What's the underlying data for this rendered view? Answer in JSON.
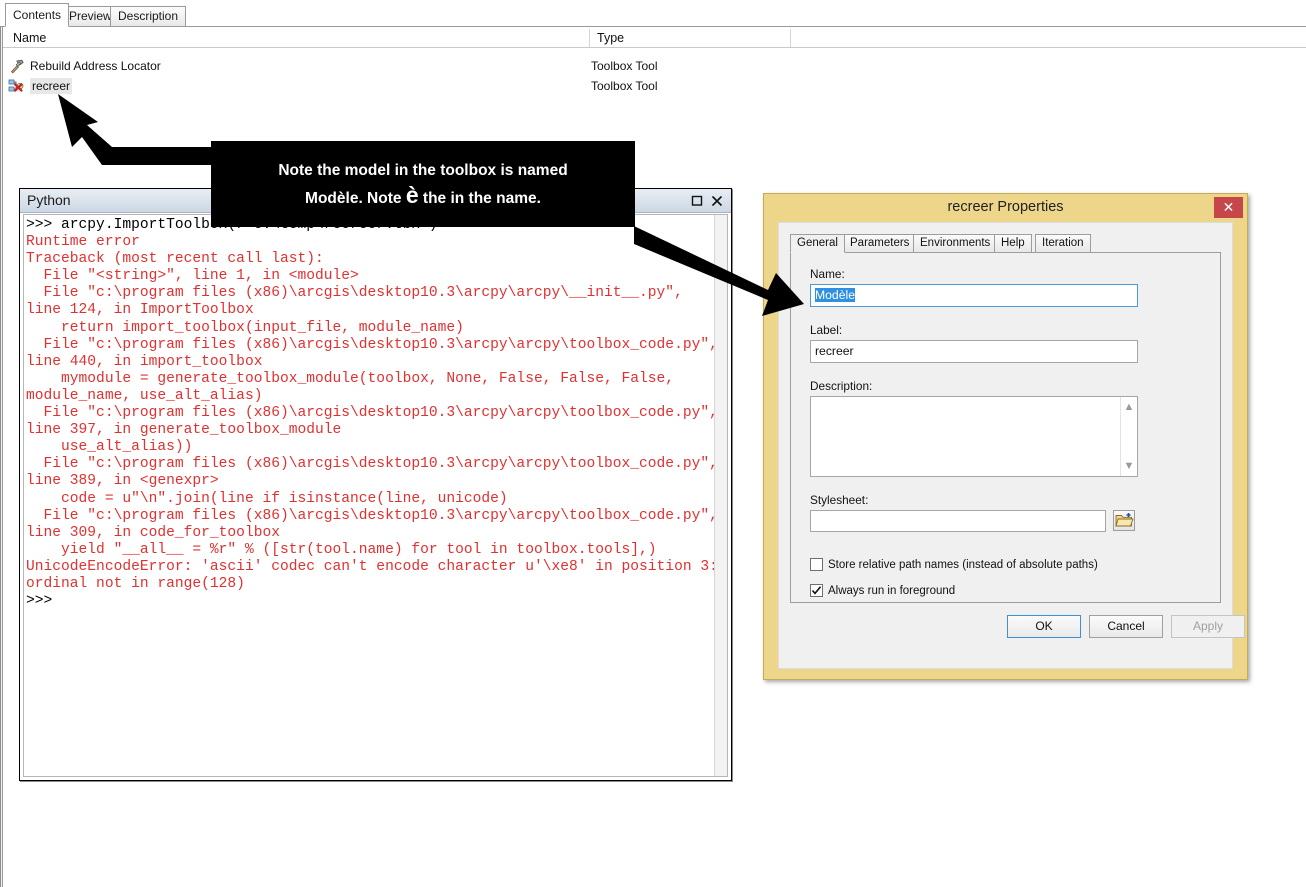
{
  "catalog": {
    "tabs": [
      {
        "label": "Contents",
        "active": true
      },
      {
        "label": "Preview",
        "active": false
      },
      {
        "label": "Description",
        "active": false
      }
    ],
    "columns": [
      "Name",
      "Type"
    ],
    "rows": [
      {
        "name": "Rebuild Address Locator",
        "type": "Toolbox Tool",
        "icon": "hammer-icon",
        "selected": false
      },
      {
        "name": "recreer",
        "type": "Toolbox Tool",
        "icon": "model-broken-icon",
        "selected": true
      }
    ]
  },
  "python_window": {
    "title": "Python",
    "buttons": {
      "maximize": "☐",
      "close": "✕"
    },
    "console_lines": [
      {
        "text": ">>> arcpy.ImportToolbox(r'c:\\temp\\recreer.tbx')",
        "style": "in"
      },
      {
        "text": "Runtime error",
        "style": "err"
      },
      {
        "text": "Traceback (most recent call last):",
        "style": "err"
      },
      {
        "text": "  File \"<string>\", line 1, in <module>",
        "style": "err"
      },
      {
        "text": "  File \"c:\\program files (x86)\\arcgis\\desktop10.3\\arcpy\\arcpy\\__init__.py\", line 124, in ImportToolbox",
        "style": "err"
      },
      {
        "text": "    return import_toolbox(input_file, module_name)",
        "style": "err"
      },
      {
        "text": "  File \"c:\\program files (x86)\\arcgis\\desktop10.3\\arcpy\\arcpy\\toolbox_code.py\", line 440, in import_toolbox",
        "style": "err"
      },
      {
        "text": "    mymodule = generate_toolbox_module(toolbox, None, False, False, False, module_name, use_alt_alias)",
        "style": "err"
      },
      {
        "text": "  File \"c:\\program files (x86)\\arcgis\\desktop10.3\\arcpy\\arcpy\\toolbox_code.py\", line 397, in generate_toolbox_module",
        "style": "err"
      },
      {
        "text": "    use_alt_alias))",
        "style": "err"
      },
      {
        "text": "  File \"c:\\program files (x86)\\arcgis\\desktop10.3\\arcpy\\arcpy\\toolbox_code.py\", line 389, in <genexpr>",
        "style": "err"
      },
      {
        "text": "    code = u\"\\n\".join(line if isinstance(line, unicode)",
        "style": "err"
      },
      {
        "text": "  File \"c:\\program files (x86)\\arcgis\\desktop10.3\\arcpy\\arcpy\\toolbox_code.py\", line 309, in code_for_toolbox",
        "style": "err"
      },
      {
        "text": "    yield \"__all__ = %r\" % ([str(tool.name) for tool in toolbox.tools],)",
        "style": "err"
      },
      {
        "text": "UnicodeEncodeError: 'ascii' codec can't encode character u'\\xe8' in position 3: ordinal not in range(128)",
        "style": "err"
      },
      {
        "text": ">>>",
        "style": "in"
      }
    ]
  },
  "properties_dialog": {
    "title": "recreer Properties",
    "close_label": "✕",
    "tabs": [
      {
        "label": "General",
        "active": true
      },
      {
        "label": "Parameters",
        "active": false
      },
      {
        "label": "Environments",
        "active": false
      },
      {
        "label": "Help",
        "active": false
      },
      {
        "label": "Iteration",
        "active": false
      }
    ],
    "fields": {
      "name_label": "Name:",
      "name_value": "Modèle",
      "label_label": "Label:",
      "label_value": "recreer",
      "description_label": "Description:",
      "description_value": "",
      "stylesheet_label": "Stylesheet:",
      "stylesheet_value": ""
    },
    "checkboxes": [
      {
        "label": "Store relative path names (instead of absolute paths)",
        "checked": false
      },
      {
        "label": "Always run in foreground",
        "checked": true
      }
    ],
    "buttons": [
      {
        "label": "OK",
        "state": "default"
      },
      {
        "label": "Cancel",
        "state": "normal"
      },
      {
        "label": "Apply",
        "state": "disabled"
      }
    ],
    "folder_icon": "open-folder-icon"
  },
  "callout": {
    "line1": "Note the model in the toolbox is named",
    "line2_pre": "Modèle. Note ",
    "line2_accent": "è",
    "line2_post": " the in the name."
  },
  "colors": {
    "dialog_gold": "#edd68a",
    "close_red": "#c6474a",
    "error_red": "#e03131",
    "selection_blue": "#2f8fe0",
    "python_titlebar": "#cdd8e4"
  }
}
